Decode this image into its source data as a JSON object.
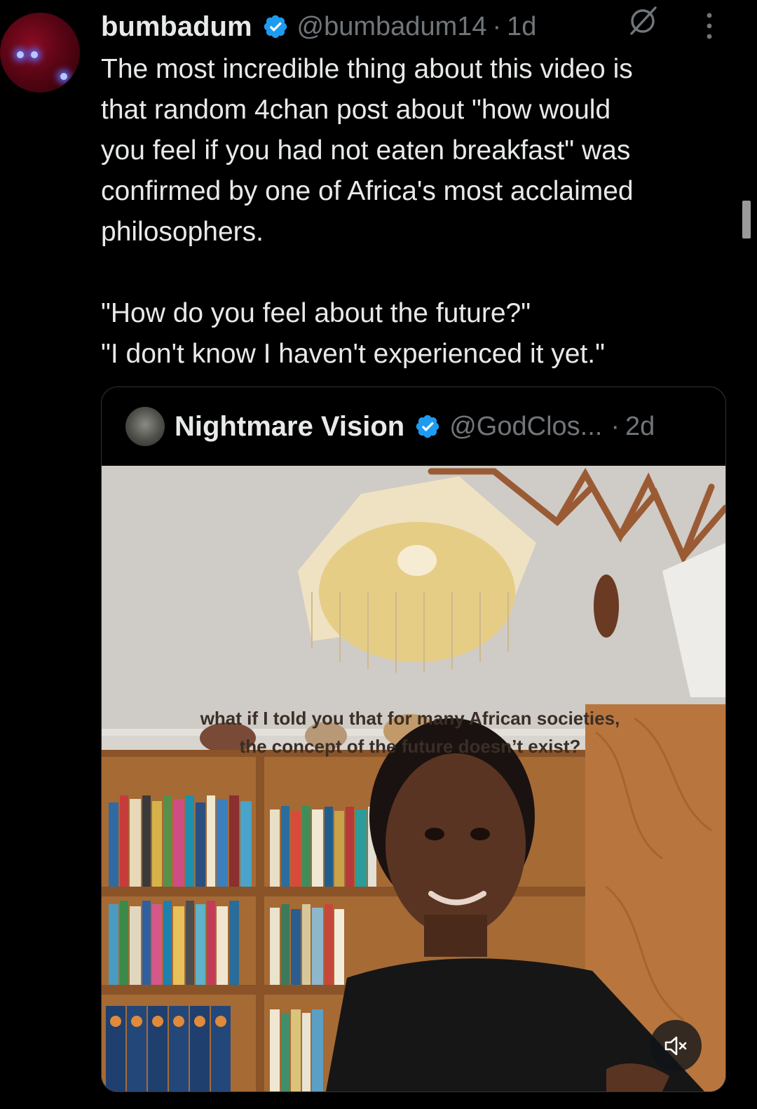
{
  "author": {
    "display_name": "bumbadum",
    "handle": "@bumbadum14",
    "separator": "·",
    "time": "1d",
    "verified": true,
    "icons": [
      "grok-icon",
      "more-options-icon"
    ]
  },
  "tweet": {
    "lines": [
      "The most incredible thing about this video is",
      "that random 4chan post about \"how would",
      "you feel if you had not eaten breakfast\" was",
      "confirmed by one of Africa's most acclaimed",
      "philosophers."
    ],
    "quote_lines": [
      "\"How do you feel about the future?\"",
      "\"I don't know I haven't experienced it yet.\""
    ]
  },
  "quoted_tweet": {
    "display_name": "Nightmare Vision",
    "handle": "@GodClos...",
    "separator": "·",
    "time": "2d",
    "verified": true,
    "video": {
      "caption_lines": [
        "what if I told you that for many African societies,",
        "the concept of the future doesn’t exist?"
      ],
      "mute_icon": "volume-muted-icon"
    }
  },
  "colors": {
    "background": "#000000",
    "text_primary": "#e7e9ea",
    "text_secondary": "#71767b",
    "verified_blue": "#1d9bf0",
    "border": "#2f3336"
  }
}
